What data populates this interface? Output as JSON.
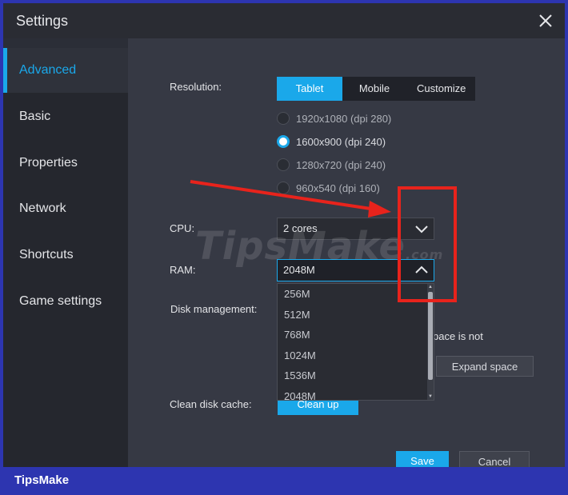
{
  "window": {
    "title": "Settings"
  },
  "sidebar": {
    "items": [
      {
        "label": "Advanced",
        "active": true
      },
      {
        "label": "Basic"
      },
      {
        "label": "Properties"
      },
      {
        "label": "Network"
      },
      {
        "label": "Shortcuts"
      },
      {
        "label": "Game settings"
      }
    ]
  },
  "resolution": {
    "label": "Resolution:",
    "tabs": [
      "Tablet",
      "Mobile",
      "Customize"
    ],
    "active_tab": "Tablet",
    "options": [
      "1920x1080  (dpi 280)",
      "1600x900  (dpi 240)",
      "1280x720  (dpi 240)",
      "960x540  (dpi 160)"
    ],
    "selected": "1600x900  (dpi 240)"
  },
  "cpu": {
    "label": "CPU:",
    "value": "2 cores"
  },
  "ram": {
    "label": "RAM:",
    "value": "2048M",
    "options": [
      "256M",
      "512M",
      "768M",
      "1024M",
      "1536M",
      "2048M"
    ]
  },
  "disk": {
    "label": "Disk management:",
    "partial_text": "pace is not",
    "expand_label": "Expand space"
  },
  "cache": {
    "label": "Clean disk cache:",
    "button": "Clean up"
  },
  "actions": {
    "save": "Save",
    "cancel": "Cancel"
  },
  "watermark": {
    "text": "TipsMake",
    "suffix": ".com"
  },
  "footer": {
    "brand": "TipsMake"
  },
  "colors": {
    "accent": "#1aa8ea",
    "frame": "#2d35b0",
    "annotation": "#e8231c"
  }
}
